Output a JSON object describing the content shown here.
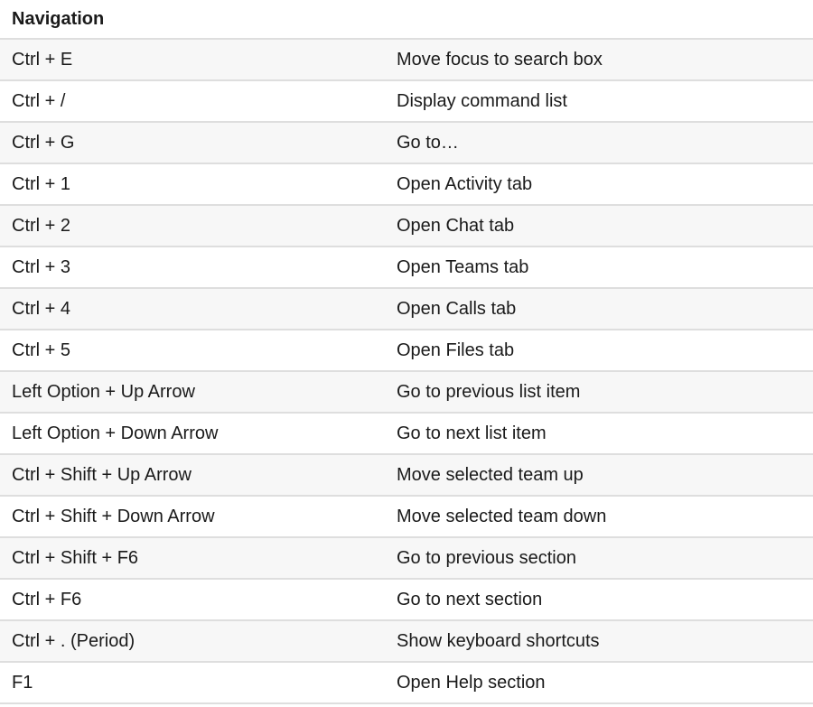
{
  "section_title": "Navigation",
  "rows": [
    {
      "keys": "Ctrl + E",
      "action": "Move focus to search box"
    },
    {
      "keys": "Ctrl + /",
      "action": "Display command list"
    },
    {
      "keys": "Ctrl + G",
      "action": "Go to…"
    },
    {
      "keys": "Ctrl + 1",
      "action": "Open Activity tab"
    },
    {
      "keys": "Ctrl + 2",
      "action": "Open Chat tab"
    },
    {
      "keys": "Ctrl + 3",
      "action": "Open Teams tab"
    },
    {
      "keys": "Ctrl + 4",
      "action": "Open Calls tab"
    },
    {
      "keys": "Ctrl + 5",
      "action": "Open Files tab"
    },
    {
      "keys": "Left Option + Up Arrow",
      "action": "Go to previous list item"
    },
    {
      "keys": "Left Option + Down Arrow",
      "action": "Go to next list item"
    },
    {
      "keys": "Ctrl + Shift + Up Arrow",
      "action": "Move selected team up"
    },
    {
      "keys": "Ctrl + Shift + Down Arrow",
      "action": "Move selected team down"
    },
    {
      "keys": "Ctrl + Shift + F6",
      "action": "Go to previous section"
    },
    {
      "keys": "Ctrl + F6",
      "action": "Go to next section"
    },
    {
      "keys": "Ctrl + . (Period)",
      "action": "Show keyboard shortcuts"
    },
    {
      "keys": "F1",
      "action": "Open Help section"
    }
  ]
}
